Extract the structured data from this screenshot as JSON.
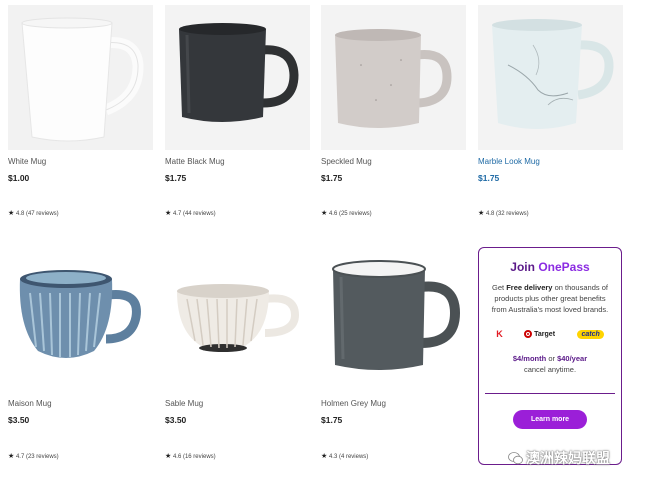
{
  "products": [
    {
      "name": "White Mug",
      "price": "$1.00",
      "rating": "4.8",
      "reviews": "(47 reviews)"
    },
    {
      "name": "Matte Black Mug",
      "price": "$1.75",
      "rating": "4.7",
      "reviews": "(44 reviews)"
    },
    {
      "name": "Speckled Mug",
      "price": "$1.75",
      "rating": "4.6",
      "reviews": "(25 reviews)"
    },
    {
      "name": "Marble Look Mug",
      "price": "$1.75",
      "rating": "4.8",
      "reviews": "(32 reviews)"
    },
    {
      "name": "Maison Mug",
      "price": "$3.50",
      "rating": "4.7",
      "reviews": "(23 reviews)"
    },
    {
      "name": "Sable Mug",
      "price": "$3.50",
      "rating": "4.6",
      "reviews": "(16 reviews)"
    },
    {
      "name": "Holmen Grey Mug",
      "price": "$1.75",
      "rating": "4.3",
      "reviews": "(4 reviews)"
    }
  ],
  "promo": {
    "title_prefix": "Join",
    "brand": "OnePass",
    "text_1": "Get",
    "text_bold": "Free delivery",
    "text_2": "on thousands of products plus other great benefits from Australia's most loved brands.",
    "logos": {
      "kmart": "K",
      "target": "Target",
      "catch": "catch"
    },
    "monthly": "$4/month",
    "or": "or",
    "yearly": "$40/year",
    "cancel": "cancel anytime.",
    "button": "Learn more"
  },
  "watermark": "澳洲辣妈联盟",
  "colors": {
    "accent": "#9b1fd8",
    "promo_border": "#6b1d8c",
    "link_blue": "#1f6aa5"
  }
}
